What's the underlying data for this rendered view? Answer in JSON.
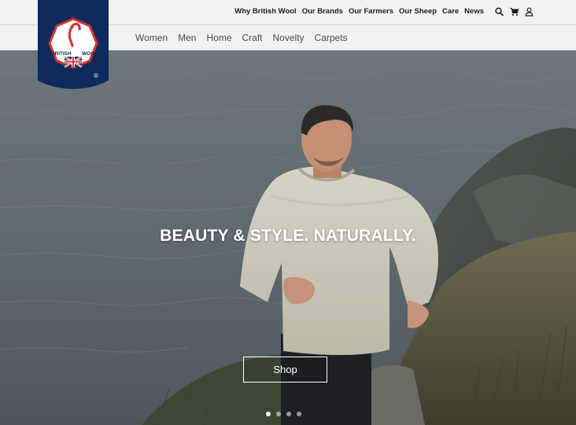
{
  "brand": {
    "logo_text_left": "BRITISH",
    "logo_text_right": "WOOL",
    "registered": "®",
    "navy": "#0e2a5c",
    "red": "#d7372f"
  },
  "utility_nav": [
    {
      "label": "Why British Wool"
    },
    {
      "label": "Our Brands"
    },
    {
      "label": "Our Farmers"
    },
    {
      "label": "Our Sheep"
    },
    {
      "label": "Care"
    },
    {
      "label": "News"
    }
  ],
  "utility_icons": [
    "search-icon",
    "cart-icon",
    "account-icon"
  ],
  "main_nav": [
    {
      "label": "Women"
    },
    {
      "label": "Men"
    },
    {
      "label": "Home"
    },
    {
      "label": "Craft"
    },
    {
      "label": "Novelty"
    },
    {
      "label": "Carpets"
    }
  ],
  "hero": {
    "headline": "BEAUTY & STYLE. NATURALLY.",
    "cta_label": "Shop",
    "slides_total": 4,
    "active_slide": 1
  }
}
